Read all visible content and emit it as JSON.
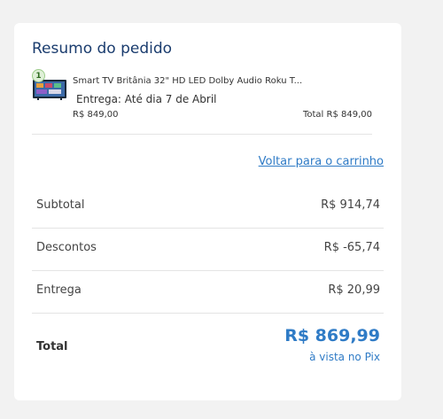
{
  "summary": {
    "title": "Resumo do pedido",
    "item": {
      "quantity": "1",
      "name": "Smart TV Britânia 32\" HD LED Dolby Audio Roku T...",
      "delivery": "Entrega: Até dia 7 de Abril",
      "unit_price": "R$ 849,00",
      "total": "Total  R$ 849,00"
    },
    "back_link": "Voltar para o carrinho",
    "rows": [
      {
        "label": "Subtotal",
        "value": "R$ 914,74"
      },
      {
        "label": "Descontos",
        "value": "R$ -65,74"
      },
      {
        "label": "Entrega",
        "value": "R$ 20,99"
      }
    ],
    "total_label": "Total",
    "total_value": "R$ 869,99",
    "total_note": "à vista no Pix"
  },
  "colors": {
    "accent": "#2f7bc6",
    "title": "#1a3c6e"
  },
  "icons": [
    "tv-thumbnail-icon"
  ]
}
